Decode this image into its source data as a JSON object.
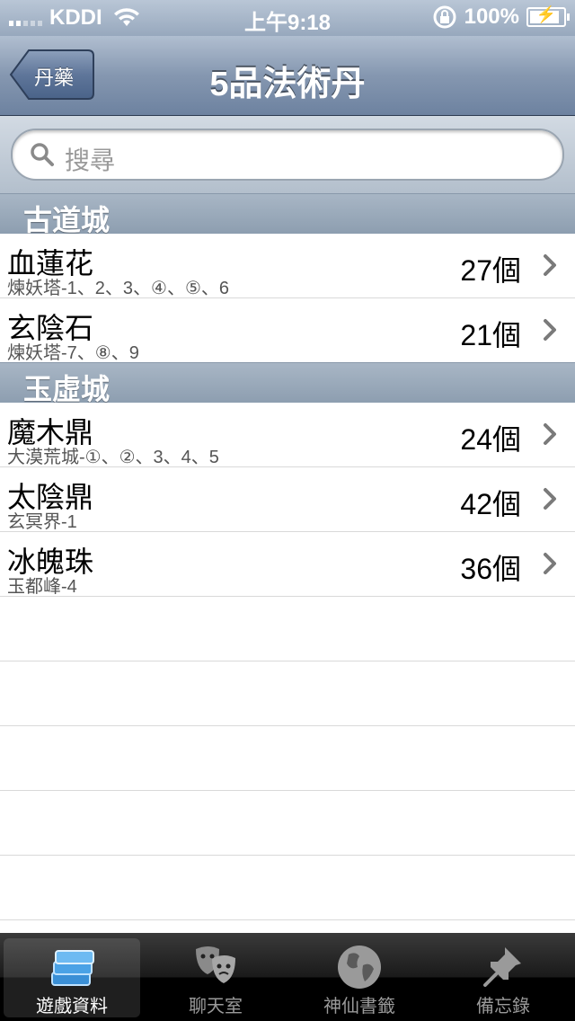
{
  "status_bar": {
    "carrier": "KDDI",
    "time": "上午9:18",
    "battery": "100%",
    "battery_level": 1.0
  },
  "nav": {
    "back_label": "丹藥",
    "title": "5品法術丹"
  },
  "search": {
    "placeholder": "搜尋"
  },
  "sections": [
    {
      "header": "古道城",
      "rows": [
        {
          "title": "血蓮花",
          "subtitle": "煉妖塔-1、2、3、④、⑤、6",
          "count": "27個"
        },
        {
          "title": "玄陰石",
          "subtitle": "煉妖塔-7、⑧、9",
          "count": "21個"
        }
      ]
    },
    {
      "header": "玉虛城",
      "rows": [
        {
          "title": "魔木鼎",
          "subtitle": "大漠荒城-①、②、3、4、5",
          "count": "24個"
        },
        {
          "title": "太陰鼎",
          "subtitle": "玄冥界-1",
          "count": "42個"
        },
        {
          "title": "冰魄珠",
          "subtitle": "玉都峰-4",
          "count": "36個"
        }
      ]
    }
  ],
  "tab_bar": {
    "tabs": [
      {
        "label": "遊戲資料",
        "icon": "stack-icon",
        "active": true
      },
      {
        "label": "聊天室",
        "icon": "masks-icon",
        "active": false
      },
      {
        "label": "神仙書籤",
        "icon": "globe-icon",
        "active": false
      },
      {
        "label": "備忘錄",
        "icon": "pushpin-icon",
        "active": false
      }
    ]
  },
  "colors": {
    "nav_bar": "#8597b0",
    "section_header": "#9aabbd",
    "tab_bar": "#1a1a1a",
    "tab_active_icon": "#5aa8e6"
  }
}
